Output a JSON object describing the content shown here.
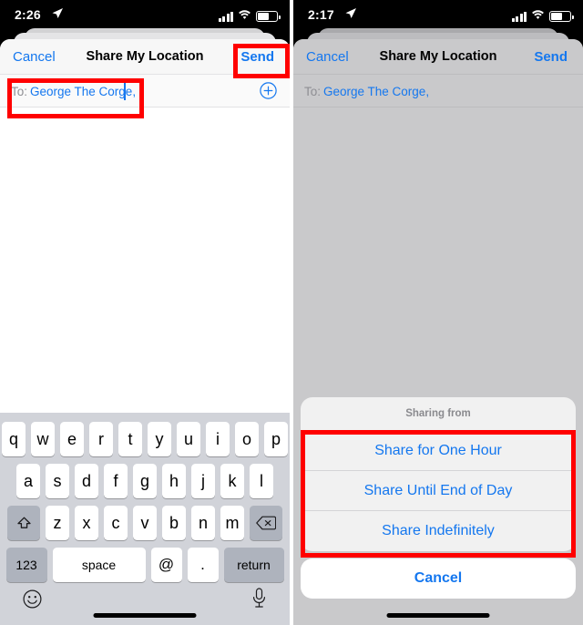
{
  "meta": {
    "accent_blue": "#1477ef",
    "annotation_red": "#ff0000",
    "keyboard_bg": "#d1d3d9"
  },
  "left_phone": {
    "status_bar": {
      "time": "2:26",
      "location_icon": "location-arrow-icon",
      "signal_icon": "cellular-bars-icon",
      "wifi_icon": "wifi-icon",
      "battery_icon": "battery-icon"
    },
    "nav_bar": {
      "cancel_label": "Cancel",
      "title": "Share My Location",
      "send_label": "Send"
    },
    "to_field": {
      "label": "To:",
      "value": "George The Corge,",
      "add_contact_icon": "plus-circle-icon"
    },
    "keyboard": {
      "row1": [
        "q",
        "w",
        "e",
        "r",
        "t",
        "y",
        "u",
        "i",
        "o",
        "p"
      ],
      "row2": [
        "a",
        "s",
        "d",
        "f",
        "g",
        "h",
        "j",
        "k",
        "l"
      ],
      "row3_shift": "shift-icon",
      "row3": [
        "z",
        "x",
        "c",
        "v",
        "b",
        "n",
        "m"
      ],
      "row3_delete": "delete-backspace-icon",
      "numbers_label": "123",
      "space_label": "space",
      "at_label": "@",
      "dot_label": ".",
      "return_label": "return",
      "emoji_icon": "emoji-smiley-icon",
      "dictation_icon": "microphone-icon"
    },
    "annotations": [
      {
        "name": "highlight-send-button"
      },
      {
        "name": "highlight-to-field"
      }
    ]
  },
  "right_phone": {
    "status_bar": {
      "time": "2:17",
      "location_icon": "location-arrow-icon",
      "signal_icon": "cellular-bars-icon",
      "wifi_icon": "wifi-icon",
      "battery_icon": "battery-icon"
    },
    "nav_bar": {
      "cancel_label": "Cancel",
      "title": "Share My Location",
      "send_label": "Send"
    },
    "to_field": {
      "label": "To:",
      "value": "George The Corge,"
    },
    "action_sheet": {
      "title": "Sharing from",
      "options": [
        "Share for One Hour",
        "Share Until End of Day",
        "Share Indefinitely"
      ],
      "cancel_label": "Cancel"
    },
    "annotations": [
      {
        "name": "highlight-share-duration-options"
      }
    ]
  }
}
